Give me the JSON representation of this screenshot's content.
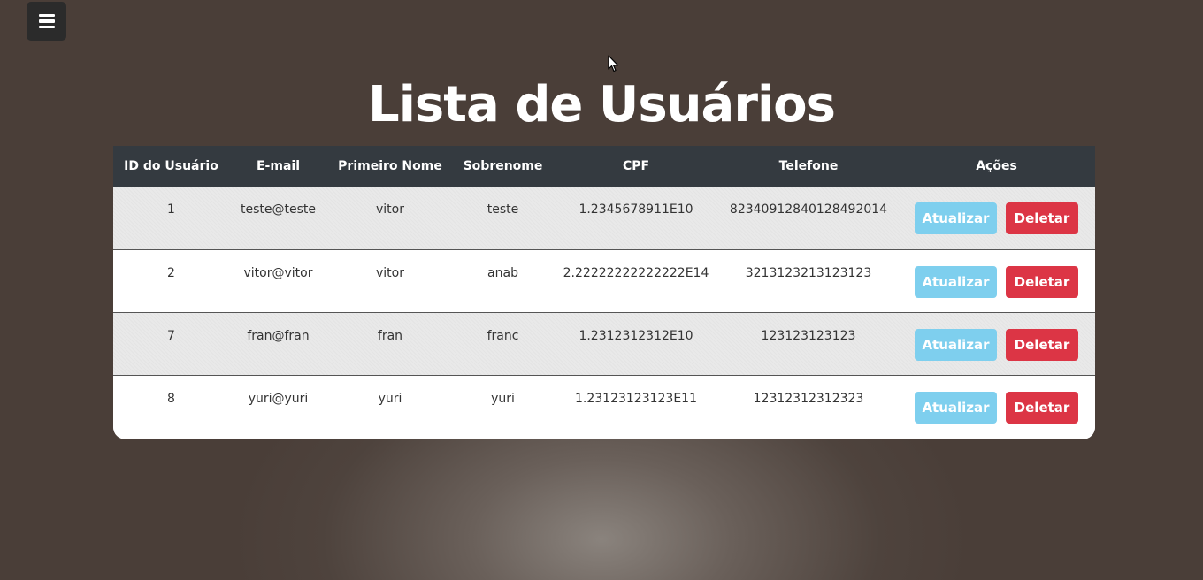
{
  "menu": {
    "icon": "hamburger-menu-icon"
  },
  "page": {
    "title": "Lista de Usuários"
  },
  "table": {
    "headers": [
      "ID do Usuário",
      "E-mail",
      "Primeiro Nome",
      "Sobrenome",
      "CPF",
      "Telefone",
      "Ações"
    ],
    "rows": [
      {
        "id": "1",
        "email": "teste@teste",
        "first_name": "vitor",
        "last_name": "teste",
        "cpf": "1.2345678911E10",
        "phone": "82340912840128492014",
        "update_label": "Atualizar",
        "delete_label": "Deletar"
      },
      {
        "id": "2",
        "email": "vitor@vitor",
        "first_name": "vitor",
        "last_name": "anab",
        "cpf": "2.22222222222222E14",
        "phone": "3213123213123123",
        "update_label": "Atualizar",
        "delete_label": "Deletar"
      },
      {
        "id": "7",
        "email": "fran@fran",
        "first_name": "fran",
        "last_name": "franc",
        "cpf": "1.2312312312E10",
        "phone": "123123123123",
        "update_label": "Atualizar",
        "delete_label": "Deletar"
      },
      {
        "id": "8",
        "email": "yuri@yuri",
        "first_name": "yuri",
        "last_name": "yuri",
        "cpf": "1.23123123123E11",
        "phone": "12312312312323",
        "update_label": "Atualizar",
        "delete_label": "Deletar"
      }
    ]
  },
  "colors": {
    "background": "#4a3e38",
    "header_bg": "#343a40",
    "update_button": "#7ecfee",
    "delete_button": "#dc3545",
    "menu_button": "#2b2b2b"
  }
}
